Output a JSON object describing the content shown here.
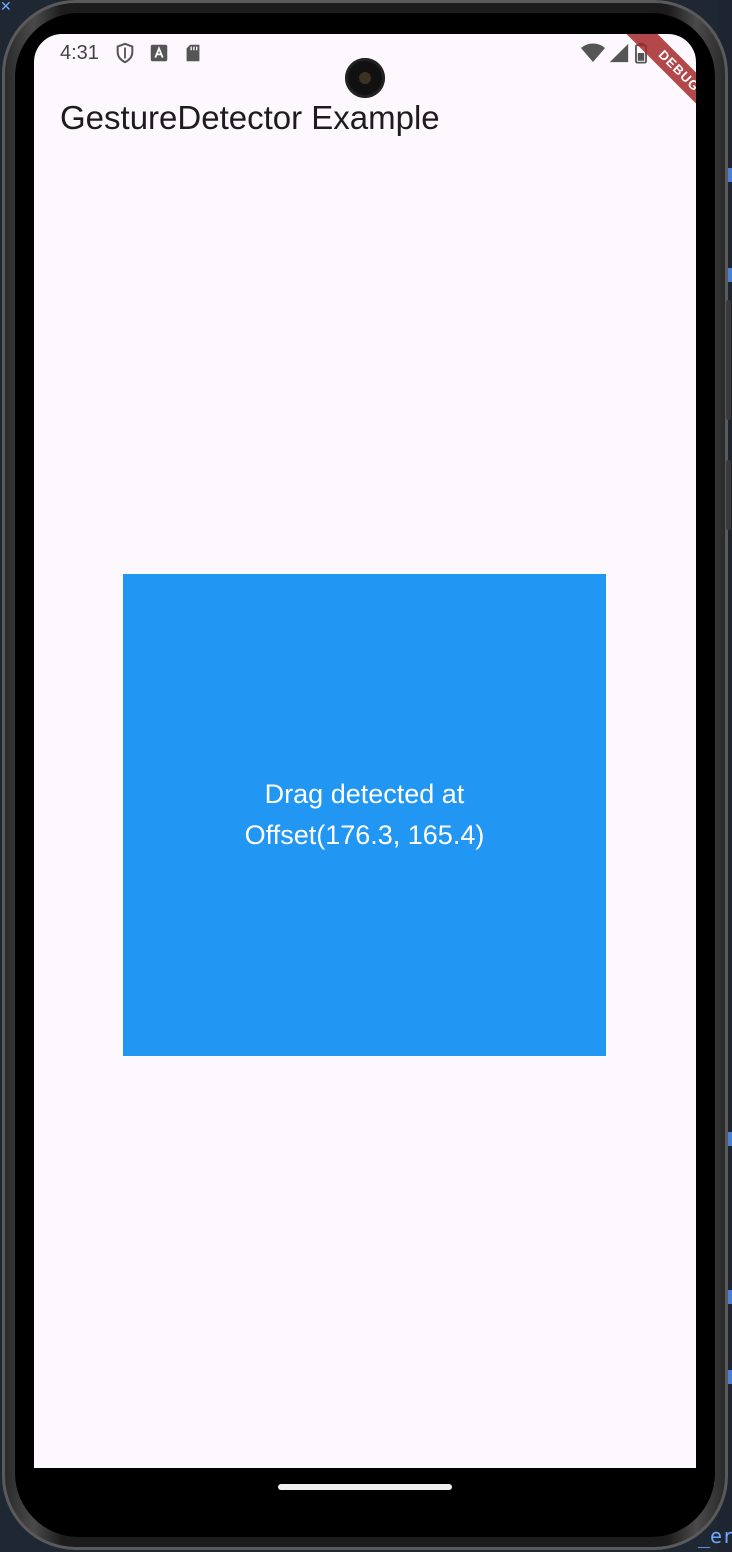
{
  "status_bar": {
    "time": "4:31",
    "left_icons": [
      "shield-icon",
      "text-a-icon",
      "sd-card-icon"
    ],
    "right_icons": [
      "wifi-icon",
      "signal-icon",
      "battery-icon"
    ]
  },
  "debug_banner": {
    "label": "DEBUG",
    "color": "#a52a2a"
  },
  "app_bar": {
    "title": "GestureDetector Example"
  },
  "gesture_box": {
    "message": "Drag detected at Offset(176.3, 165.4)",
    "color": "#2196f3"
  },
  "ide": {
    "partial_text": "_er"
  },
  "colors": {
    "screen_background": "#fdf7fe",
    "title_text": "#1d1b20"
  }
}
